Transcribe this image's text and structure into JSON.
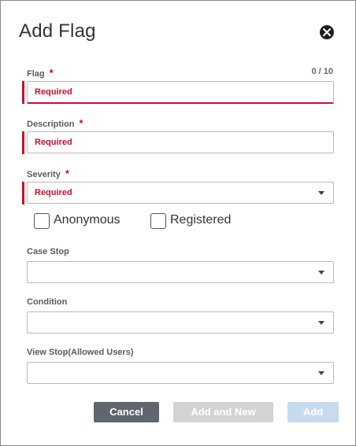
{
  "dialog": {
    "title": "Add Flag",
    "close_icon": "close-icon"
  },
  "fields": {
    "flag": {
      "label": "Flag",
      "required_mark": "*",
      "counter": "0 / 10",
      "placeholder": "Required",
      "value": ""
    },
    "description": {
      "label": "Description",
      "required_mark": "*",
      "placeholder": "Required",
      "value": ""
    },
    "severity": {
      "label": "Severity",
      "required_mark": "*",
      "placeholder": "Required",
      "selected": ""
    },
    "case_stop": {
      "label": "Case Stop",
      "selected": ""
    },
    "condition": {
      "label": "Condition",
      "selected": ""
    },
    "view_stop": {
      "label": "View Stop(Allowed Users)",
      "selected": ""
    }
  },
  "checkboxes": {
    "anonymous": {
      "label": "Anonymous",
      "checked": false
    },
    "registered": {
      "label": "Registered",
      "checked": false
    }
  },
  "buttons": {
    "cancel": "Cancel",
    "add_and_new": "Add and New",
    "add": "Add"
  },
  "colors": {
    "error": "#c8102e",
    "cancel_bg": "#5f6670",
    "add_new_bg": "#d3d3d3",
    "add_bg": "#c6dcee"
  }
}
